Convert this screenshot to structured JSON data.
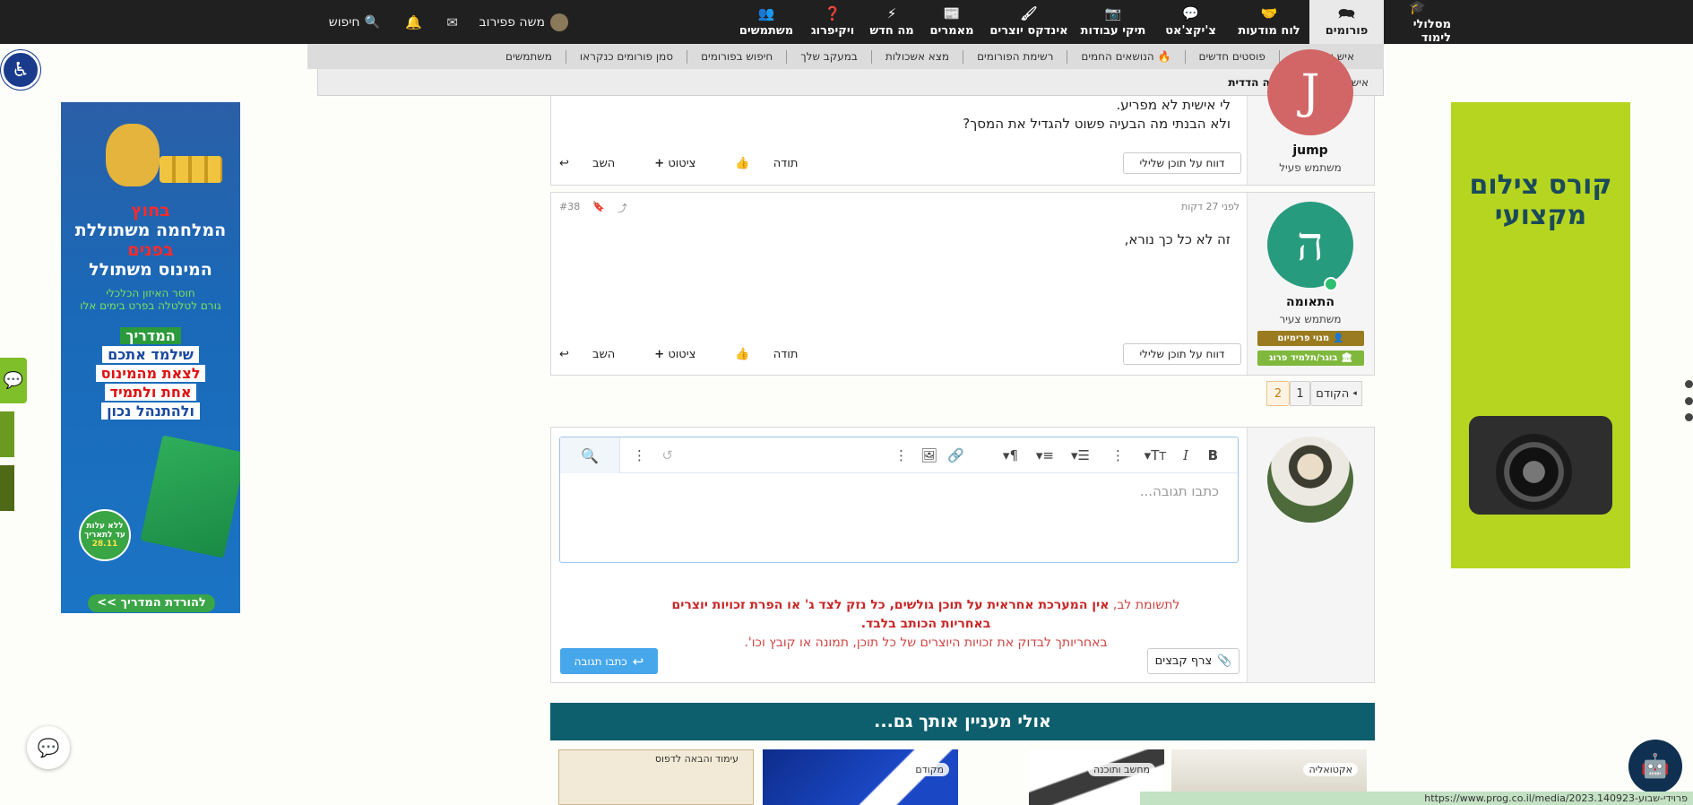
{
  "nav": {
    "items": [
      {
        "id": "learning",
        "label": "מסלולי לימוד",
        "icon": "graduation-cap-icon",
        "glyph": "🎓"
      },
      {
        "id": "forums",
        "label": "פורומים",
        "icon": "comments-icon",
        "glyph": "🗪"
      },
      {
        "id": "board",
        "label": "לוח מודעות",
        "icon": "handshake-icon",
        "glyph": "🤝"
      },
      {
        "id": "chat",
        "label": "צ'יקצ'אט",
        "icon": "chat-bubble-icon",
        "glyph": "💬"
      },
      {
        "id": "portfolio",
        "label": "תיקי עבודות",
        "icon": "camera-icon",
        "glyph": "📷"
      },
      {
        "id": "creators",
        "label": "אינדקס יוצרים",
        "icon": "brush-icon",
        "glyph": "🖌"
      },
      {
        "id": "articles",
        "label": "מאמרים",
        "icon": "newspaper-icon",
        "glyph": "📰"
      },
      {
        "id": "whatsnew",
        "label": "מה חדש",
        "icon": "bolt-icon",
        "glyph": "⚡"
      },
      {
        "id": "wiki",
        "label": "ויקיפרוג",
        "icon": "question-icon",
        "glyph": "❓"
      },
      {
        "id": "users",
        "label": "משתמשים",
        "icon": "users-icon",
        "glyph": "👥"
      }
    ],
    "username": "משה פפירוב",
    "search_label": "חיפוש"
  },
  "subnav": [
    "איש את רעהו",
    "פוסטים חדשים",
    "הנושאים החמים",
    "רשימת הפורומים",
    "מצא אשכולות",
    "במעקב שלך",
    "חיפוש בפורומים",
    "סמן פורומים כנקראו",
    "משתמשים"
  ],
  "subnav_hot_emoji": "🔥",
  "subnav2": [
    {
      "label": "איש את רעהו",
      "bold": false
    },
    {
      "label": "עזרה הדדית",
      "bold": true
    }
  ],
  "post1": {
    "username": "jump",
    "avatar_letter": "J",
    "user_title": "משתמש פעיל",
    "lines": [
      "לי אישית לא מפריע.",
      "ולא הבנתי מה הבעיה פשוט להגדיל את המסך?"
    ],
    "report": "דווח על תוכן שלילי",
    "like": "תודה",
    "quote": "ציטוט",
    "reply": "השב"
  },
  "post2": {
    "time": "לפני 27 דקות",
    "number": "#38",
    "username": "התאומה",
    "avatar_letter": "ה",
    "user_title": "משתמש צעיר",
    "badges": [
      "מנוי פרימיום",
      "בוגר/תלמיד פרוג"
    ],
    "text": "זה לא כל כך נורא,",
    "report": "דווח על תוכן שלילי",
    "like": "תודה",
    "quote": "ציטוט",
    "reply": "השב"
  },
  "pagination": {
    "prev": "הקודם",
    "pages": [
      "1",
      "2"
    ],
    "current": "2"
  },
  "editor": {
    "placeholder": "כתבו תגובה...",
    "disclaimer_prefix": "לתשומת לב,",
    "disclaimer_bold": "אין המערכת אחראית על תוכן גולשים, כל נזק לצד ג' או הפרת זכויות יוצרים באחריות הכותב בלבד.",
    "disclaimer_line2": "באחריותך לבדוק את זכויות היוצרים של כל תוכן, תמונה או קובץ וכו'.",
    "attach_label": "צרף קבצים",
    "reply_label": "כתבו תגובה"
  },
  "related": {
    "title": "אולי מעניין אותך גם...",
    "tags": [
      "אקטואליה",
      "מחשב ותוכנה",
      "מקודם",
      "עימוד והבאה לדפוס"
    ]
  },
  "ad_left": {
    "line1": "בחוץ",
    "line2": "המלחמה משתוללת",
    "line3": "בפנים",
    "line4": "המינוס משתולל",
    "line5": "חוסר האיזון הכלכלי",
    "line6": "גורם לטלטלה בפרט בימים אלו",
    "guide1": "המדריך",
    "guide2": "שילמד אתכם",
    "guide3": "לצאת מהמינוס",
    "guide4": "אחת ולתמיד",
    "guide5": "ולהתנהל נכון",
    "badge1": "ללא עלות",
    "badge2": "עד לתאריך",
    "badge3": "28.11",
    "cta": "להורדת המדריך >>"
  },
  "ad_right": {
    "line1": "קורס צילום",
    "line2": "מקצועי"
  },
  "status_url": "https://www.prog.co.il/media/2023.140923-פרוידי-שבוע"
}
